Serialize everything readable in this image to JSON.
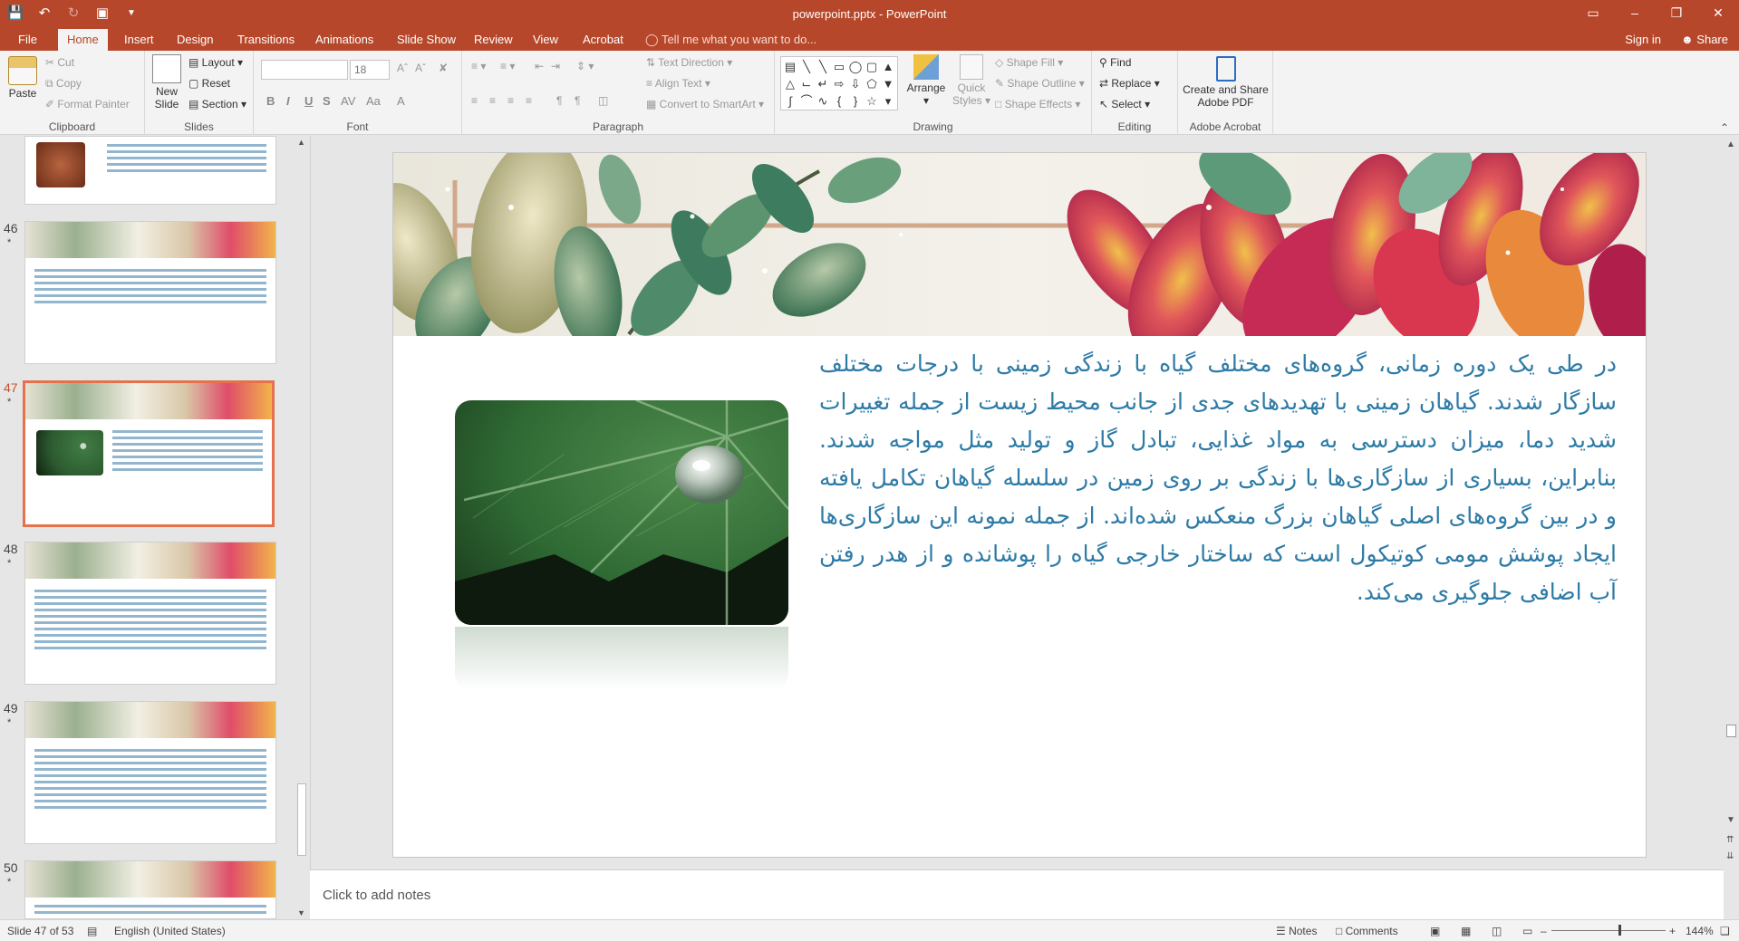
{
  "window": {
    "title": "powerpoint.pptx - PowerPoint",
    "quick_access": [
      "save-icon",
      "undo-icon",
      "redo-icon",
      "start-from-beginning-icon",
      "customize-icon"
    ]
  },
  "tabs": {
    "items": [
      "File",
      "Home",
      "Insert",
      "Design",
      "Transitions",
      "Animations",
      "Slide Show",
      "Review",
      "View",
      "Acrobat"
    ],
    "active": "Home",
    "tell_me": "Tell me what you want to do...",
    "sign_in": "Sign in",
    "share": "Share"
  },
  "ribbon": {
    "clipboard": {
      "label": "Clipboard",
      "paste": "Paste",
      "cut": "Cut",
      "copy": "Copy",
      "format_painter": "Format Painter"
    },
    "slides": {
      "label": "Slides",
      "new_slide_line1": "New",
      "new_slide_line2": "Slide",
      "layout": "Layout",
      "reset": "Reset",
      "section": "Section"
    },
    "font": {
      "label": "Font",
      "font_name": "",
      "font_size": "18"
    },
    "paragraph": {
      "label": "Paragraph",
      "text_direction": "Text Direction",
      "align_text": "Align Text",
      "convert_smartart": "Convert to SmartArt"
    },
    "drawing": {
      "label": "Drawing",
      "arrange": "Arrange",
      "quick_styles_line1": "Quick",
      "quick_styles_line2": "Styles",
      "shape_fill": "Shape Fill",
      "shape_outline": "Shape Outline",
      "shape_effects": "Shape Effects"
    },
    "editing": {
      "label": "Editing",
      "find": "Find",
      "replace": "Replace",
      "select": "Select"
    },
    "acrobat": {
      "label": "Adobe Acrobat",
      "create_line1": "Create and Share",
      "create_line2": "Adobe PDF"
    }
  },
  "thumbnails": [
    {
      "number": "46",
      "star": "*"
    },
    {
      "number": "47",
      "star": "*"
    },
    {
      "number": "48",
      "star": "*"
    },
    {
      "number": "49",
      "star": "*"
    },
    {
      "number": "50",
      "star": "*"
    }
  ],
  "slide": {
    "body_text": "در طی یک دوره زمانی، گروه‌های مختلف گیاه با زندگی زمینی با درجات مختلف سازگار شدند. گیاهان زمینی با تهدیدهای جدی از جانب محیط زیست از جمله تغییرات شدید دما، میزان دسترسی به مواد غذایی، تبادل گاز و تولید مثل مواجه شدند. بنابراین، بسیاری از سازگاری‌ها با زندگی بر روی زمین در سلسله گیاهان تکامل یافته و در بین گروه‌های اصلی گیاهان بزرگ منعکس شده‌اند. از جمله نمونه این سازگاری‌ها ایجاد پوشش مومی کوتیکول است که ساختار خارجی گیاه را پوشانده و از هدر رفتن آب اضافی جلوگیری می‌کند."
  },
  "notes": {
    "placeholder": "Click to add notes"
  },
  "status": {
    "slide_info": "Slide 47 of 53",
    "language": "English (United States)",
    "notes": "Notes",
    "comments": "Comments",
    "zoom": "144%"
  },
  "colors": {
    "accent": "#b7472a",
    "slide_text": "#2e7ba6",
    "active_thumb_border": "#e5714e"
  }
}
